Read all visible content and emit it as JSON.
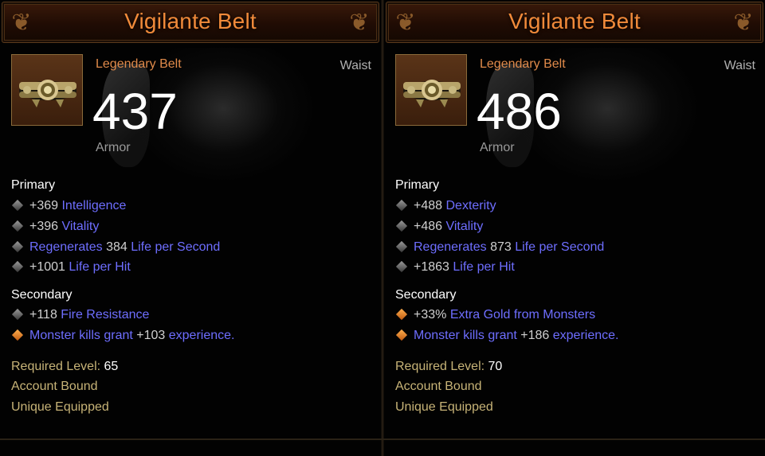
{
  "items": [
    {
      "title": "Vigilante Belt",
      "type": "Legendary Belt",
      "slot": "Waist",
      "armor": "437",
      "armor_label": "Armor",
      "primary_label": "Primary",
      "primary": [
        {
          "prefix": "+369 ",
          "stat": "Intelligence",
          "suffix": ""
        },
        {
          "prefix": "+396 ",
          "stat": "Vitality",
          "suffix": ""
        },
        {
          "prefix": "",
          "stat": "Regenerates ",
          "value": "384",
          "stat2": " Life per Second"
        },
        {
          "prefix": "+1001 ",
          "stat": "Life per Hit",
          "suffix": ""
        }
      ],
      "secondary_label": "Secondary",
      "secondary": [
        {
          "prefix": "+118 ",
          "stat": "Fire Resistance",
          "bullet": "gray"
        },
        {
          "prefix": "",
          "stat": "Monster kills grant ",
          "value": "+103",
          "stat2": " experience.",
          "bullet": "orange"
        }
      ],
      "required_level_label": "Required Level: ",
      "required_level": "65",
      "account_bound": "Account Bound",
      "unique_equipped": "Unique Equipped"
    },
    {
      "title": "Vigilante Belt",
      "type": "Legendary Belt",
      "slot": "Waist",
      "armor": "486",
      "armor_label": "Armor",
      "primary_label": "Primary",
      "primary": [
        {
          "prefix": "+488 ",
          "stat": "Dexterity",
          "suffix": ""
        },
        {
          "prefix": "+486 ",
          "stat": "Vitality",
          "suffix": ""
        },
        {
          "prefix": "",
          "stat": "Regenerates ",
          "value": "873",
          "stat2": " Life per Second"
        },
        {
          "prefix": "+1863 ",
          "stat": "Life per Hit",
          "suffix": ""
        }
      ],
      "secondary_label": "Secondary",
      "secondary": [
        {
          "prefix": "+33% ",
          "stat": "Extra Gold from Monsters",
          "bullet": "orange"
        },
        {
          "prefix": "",
          "stat": "Monster kills grant ",
          "value": "+186",
          "stat2": " experience.",
          "bullet": "orange"
        }
      ],
      "required_level_label": "Required Level: ",
      "required_level": "70",
      "account_bound": "Account Bound",
      "unique_equipped": "Unique Equipped"
    }
  ],
  "colors": {
    "title": "#f08a3a",
    "item_type": "#e08a4a",
    "stat_blue": "#6e6eff",
    "gold_text": "#c7b377"
  },
  "icons": {
    "item": "belt-icon",
    "bullet_gray": "gray-diamond-bullet-icon",
    "bullet_orange": "orange-diamond-bullet-icon"
  }
}
